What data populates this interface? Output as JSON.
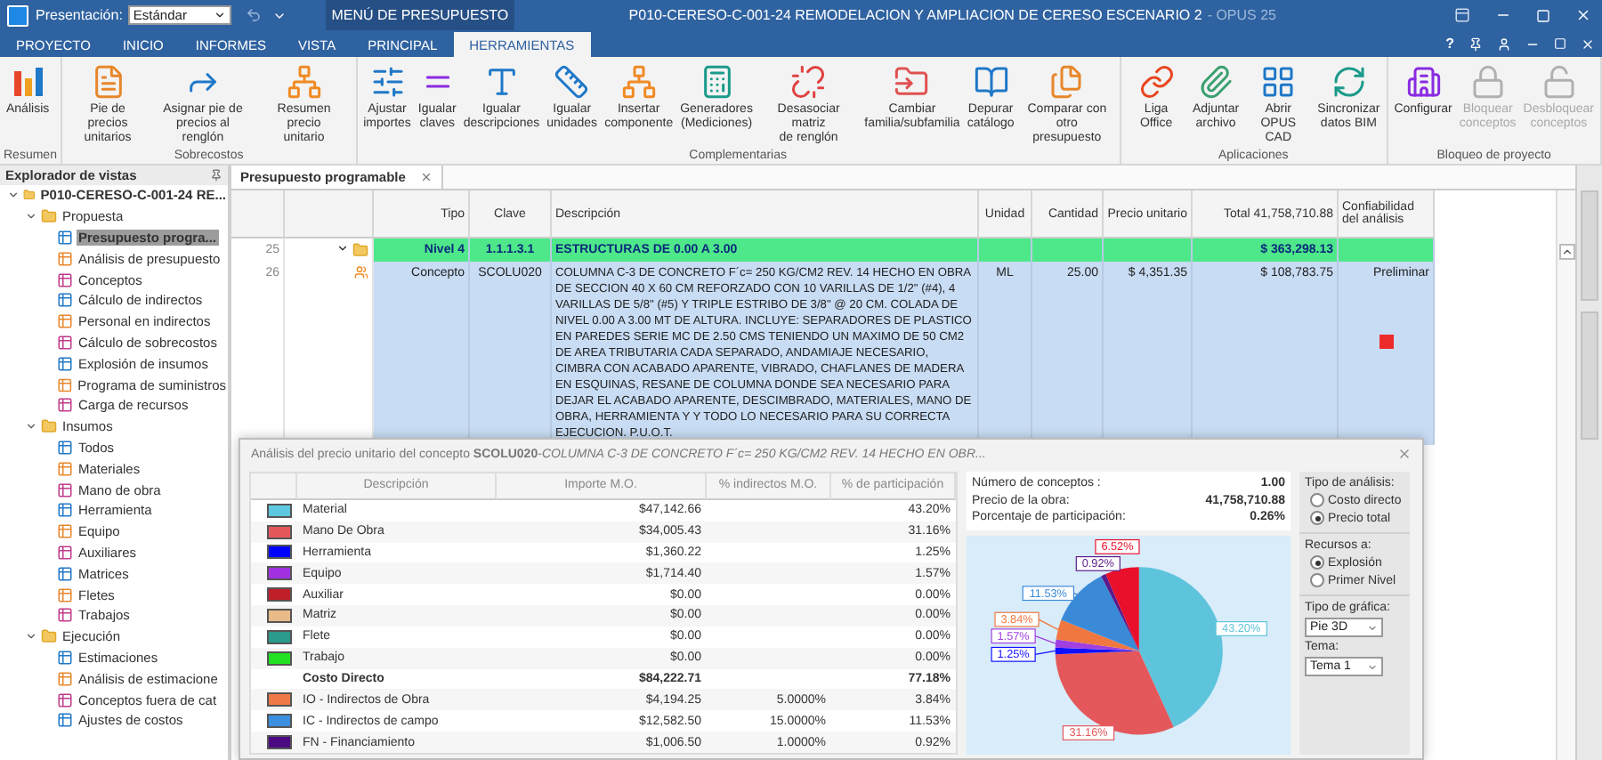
{
  "title_bar": {
    "presentation_label": "Presentación:",
    "presentation_value": "Estándar",
    "context_header": "MENÚ DE PRESUPUESTO",
    "title": "P010-CERESO-C-001-24 REMODELACION Y AMPLIACION DE CERESO ESCENARIO 2",
    "app_name": "- OPUS 25",
    "help": "?"
  },
  "menu_tabs": [
    {
      "label": "PROYECTO",
      "selected": false
    },
    {
      "label": "INICIO",
      "selected": false
    },
    {
      "label": "INFORMES",
      "selected": false
    },
    {
      "label": "VISTA",
      "selected": false
    },
    {
      "label": "PRINCIPAL",
      "selected": false
    },
    {
      "label": "HERRAMIENTAS",
      "selected": true
    }
  ],
  "ribbon": {
    "groups": [
      {
        "label": "Resumen",
        "buttons": [
          {
            "label": "Análisis",
            "disabled": false
          }
        ]
      },
      {
        "label": "Sobrecostos",
        "buttons": [
          {
            "label": "Pie de precios\nunitarios",
            "disabled": false
          },
          {
            "label": "Asignar pie de\nprecios al renglón",
            "disabled": false
          },
          {
            "label": "Resumen precio\nunitario",
            "disabled": false
          }
        ]
      },
      {
        "label": "Complementarias",
        "buttons": [
          {
            "label": "Ajustar\nimportes",
            "disabled": false
          },
          {
            "label": "Igualar\nclaves",
            "disabled": false
          },
          {
            "label": "Igualar\ndescripciones",
            "disabled": false
          },
          {
            "label": "Igualar\nunidades",
            "disabled": false
          },
          {
            "label": "Insertar\ncomponente",
            "disabled": false
          },
          {
            "label": "Generadores\n(Mediciones)",
            "disabled": false
          },
          {
            "label": "Desasociar matriz\nde renglón",
            "disabled": false
          },
          {
            "label": "Cambiar\nfamilia/subfamilia",
            "disabled": false
          },
          {
            "label": "Depurar\ncatálogo",
            "disabled": false
          },
          {
            "label": "Comparar con\notro presupuesto",
            "disabled": false
          }
        ]
      },
      {
        "label": "Aplicaciones",
        "buttons": [
          {
            "label": "Liga Office",
            "disabled": false
          },
          {
            "label": "Adjuntar\narchivo",
            "disabled": false
          },
          {
            "label": "Abrir\nOPUS CAD",
            "disabled": false
          },
          {
            "label": "Sincronizar\ndatos BIM",
            "disabled": false
          }
        ]
      },
      {
        "label": "Bloqueo de proyecto",
        "buttons": [
          {
            "label": "Configurar",
            "disabled": false
          },
          {
            "label": "Bloquear\nconceptos",
            "disabled": true
          },
          {
            "label": "Desbloquear\nconceptos",
            "disabled": true
          }
        ]
      }
    ]
  },
  "explorer": {
    "title": "Explorador de vistas",
    "tree": [
      {
        "label": "P010-CERESO-C-001-24 RE...",
        "expanded": true,
        "selected": false,
        "children": [
          {
            "label": "Propuesta",
            "expanded": true,
            "selected": false,
            "children": [
              {
                "label": "Presupuesto progra...",
                "selected": true
              },
              {
                "label": "Análisis de presupuesto",
                "selected": false
              },
              {
                "label": "Conceptos",
                "selected": false
              },
              {
                "label": "Cálculo de indirectos",
                "selected": false
              },
              {
                "label": "Personal en indirectos",
                "selected": false
              },
              {
                "label": "Cálculo de sobrecostos",
                "selected": false
              },
              {
                "label": "Explosión de insumos",
                "selected": false
              },
              {
                "label": "Programa de suministros",
                "selected": false
              },
              {
                "label": "Carga de recursos",
                "selected": false
              }
            ]
          },
          {
            "label": "Insumos",
            "expanded": true,
            "selected": false,
            "children": [
              {
                "label": "Todos",
                "selected": false
              },
              {
                "label": "Materiales",
                "selected": false
              },
              {
                "label": "Mano de obra",
                "selected": false
              },
              {
                "label": "Herramienta",
                "selected": false
              },
              {
                "label": "Equipo",
                "selected": false
              },
              {
                "label": "Auxiliares",
                "selected": false
              },
              {
                "label": "Matrices",
                "selected": false
              },
              {
                "label": "Fletes",
                "selected": false
              },
              {
                "label": "Trabajos",
                "selected": false
              }
            ]
          },
          {
            "label": "Ejecución",
            "expanded": true,
            "selected": false,
            "children": [
              {
                "label": "Estimaciones",
                "selected": false
              },
              {
                "label": "Análisis de estimacione",
                "selected": false
              },
              {
                "label": "Conceptos fuera de cat",
                "selected": false
              },
              {
                "label": "Ajustes de costos",
                "selected": false
              }
            ]
          }
        ]
      }
    ]
  },
  "document_tab": {
    "label": "Presupuesto programable"
  },
  "grid": {
    "columns": [
      "Tipo",
      "Clave",
      "Descripción",
      "Unidad",
      "Cantidad",
      "Precio unitario",
      "Total 41,758,710.88",
      "Confiabilidad\ndel análisis"
    ],
    "rows": [
      {
        "number": "25",
        "kind": "level",
        "expanded": true,
        "tipo": "Nivel 4",
        "clave": "1.1.1.3.1",
        "descripcion": "ESTRUCTURAS DE 0.00 A 3.00",
        "total": "$ 363,298.13"
      },
      {
        "number": "26",
        "kind": "concept",
        "tipo": "Concepto",
        "clave": "SCOLU020",
        "descripcion": "COLUMNA C-3 DE CONCRETO F´c= 250 KG/CM2 REV. 14 HECHO EN OBRA DE SECCION 40 X 60 CM REFORZADO CON 10 VARILLAS DE 1/2\" (#4), 4 VARILLAS DE 5/8\" (#5) Y TRIPLE ESTRIBO DE 3/8\" @ 20 CM. COLADA DE NIVEL 0.00 A 3.00 MT DE ALTURA. INCLUYE: SEPARADORES DE PLASTICO EN PAREDES SERIE MC DE 2.50 CMS TENIENDO UN MAXIMO DE 50 CM2 DE AREA TRIBUTARIA CADA SEPARADO, ANDAMIAJE NECESARIO, CIMBRA CON ACABADO APARENTE,  VIBRADO, CHAFLANES DE MADERA EN ESQUINAS, RESANE DE COLUMNA DONDE SEA NECESARIO PARA DEJAR EL ACABADO APARENTE, DESCIMBRADO, MATERIALES, MANO DE OBRA, HERRAMIENTA Y  Y TODO LO NECESARIO PARA SU CORRECTA EJECUCION. P.U.O.T.",
        "unidad": "ML",
        "cantidad": "25.00",
        "precio_unitario": "$ 4,351.35",
        "total": "$ 108,783.75",
        "confiabilidad": "Preliminar",
        "color": "#ee2b2b"
      }
    ]
  },
  "analysis_panel": {
    "title": "Análisis del precio unitario del concepto **SCOLU020**-*COLUMNA C-3 DE CONCRETO F´c= 250 KG/CM2 REV. 14 HECHO EN OBR...*",
    "columns": [
      "Descripción",
      "Importe M.O.",
      "% indirectos M.O.",
      "% de participación"
    ],
    "rows": [
      {
        "kind": "item",
        "color": "#5ec8e0",
        "description": "Material",
        "amount": "$47,142.66",
        "share": "43.20%"
      },
      {
        "kind": "item",
        "color": "#e4585c",
        "description": "Mano De Obra",
        "amount": "$34,005.43",
        "share": "31.16%"
      },
      {
        "kind": "item",
        "color": "#0000ff",
        "description": "Herramienta",
        "amount": "$1,360.22",
        "share": "1.25%"
      },
      {
        "kind": "item",
        "color": "#a030e0",
        "description": "Equipo",
        "amount": "$1,714.40",
        "share": "1.57%"
      },
      {
        "kind": "item",
        "color": "#c01f2a",
        "description": "Auxiliar",
        "amount": "$0.00",
        "share": "0.00%"
      },
      {
        "kind": "item",
        "color": "#e8ba88",
        "description": "Matriz",
        "amount": "$0.00",
        "share": "0.00%"
      },
      {
        "kind": "item",
        "color": "#2a9a8c",
        "description": "Flete",
        "amount": "$0.00",
        "share": "0.00%"
      },
      {
        "kind": "item",
        "color": "#22e022",
        "description": "Trabajo",
        "amount": "$0.00",
        "share": "0.00%"
      },
      {
        "kind": "total",
        "description": "Costo Directo",
        "amount": "$84,222.71",
        "share": "77.18%"
      },
      {
        "kind": "item",
        "color": "#f07a45",
        "description": "IO - Indirectos de Obra",
        "amount": "$4,194.25",
        "indirect": "5.0000%",
        "share": "3.84%"
      },
      {
        "kind": "item",
        "color": "#3c8ee0",
        "description": "IC - Indirectos de campo",
        "amount": "$12,582.50",
        "indirect": "15.0000%",
        "share": "11.53%"
      },
      {
        "kind": "item",
        "color": "#4b0a82",
        "description": "FN - Financiamiento",
        "amount": "$1,006.50",
        "indirect": "1.0000%",
        "share": "0.92%"
      }
    ],
    "stats": [
      {
        "label": "Número de conceptos :",
        "value": "1.00"
      },
      {
        "label": "Precio de la obra:",
        "value": "41,758,710.88"
      },
      {
        "label": "Porcentaje de participación:",
        "value": "0.26%"
      }
    ],
    "chart_data": {
      "type": "pie",
      "values": [
        43.2,
        31.16,
        1.25,
        1.57,
        3.84,
        11.53,
        0.92,
        6.52
      ],
      "data_labels": true,
      "value_labels": [
        "43.20%",
        "31.16%",
        "1.25%",
        "1.57%",
        "3.84%",
        "11.53%",
        "0.92%",
        "6.52%"
      ]
    },
    "analysis_type": {
      "label": "Tipo de análisis:",
      "options": [
        {
          "label": "Costo directo",
          "selected": false
        },
        {
          "label": "Precio total",
          "selected": true
        }
      ]
    },
    "resources": {
      "label": "Recursos a:",
      "options": [
        {
          "label": "Explosión",
          "selected": true
        },
        {
          "label": "Primer Nivel",
          "selected": false
        }
      ]
    },
    "chart_type": {
      "label": "Tipo de gráfica:",
      "value": "Pie 3D"
    },
    "theme": {
      "label": "Tema:",
      "value": "Tema 1"
    }
  }
}
